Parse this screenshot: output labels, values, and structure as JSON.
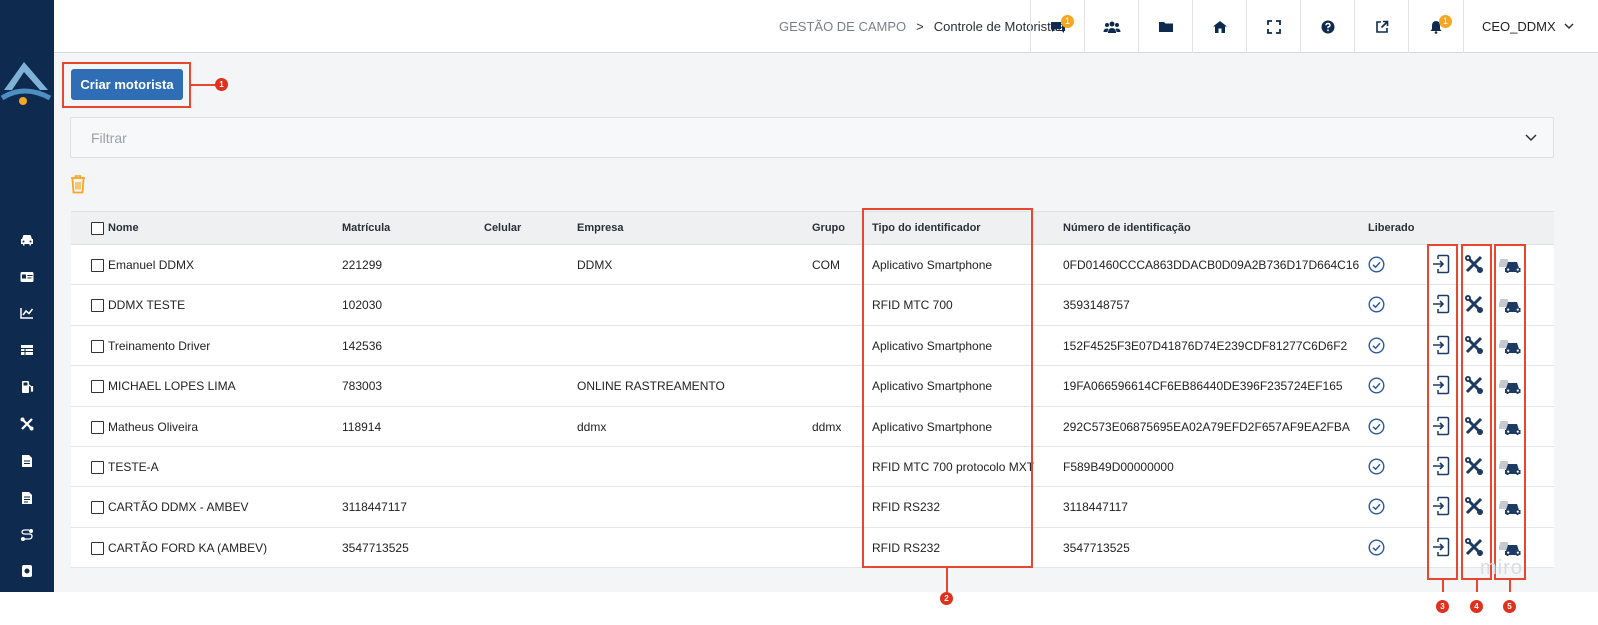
{
  "topbar": {
    "breadcrumb_parent": "GESTÃO DE CAMPO",
    "breadcrumb_sep": ">",
    "breadcrumb_current": "Controle de Motoristas",
    "chat_badge": "1",
    "notif_badge": "1",
    "user": "CEO_DDMX"
  },
  "main": {
    "create_button": "Criar motorista",
    "filter_placeholder": "Filtrar"
  },
  "table": {
    "columns": {
      "nome": "Nome",
      "matricula": "Matrícula",
      "celular": "Celular",
      "empresa": "Empresa",
      "grupo": "Grupo",
      "tipo": "Tipo do identificador",
      "numero": "Número de identificação",
      "liberado": "Liberado"
    },
    "rows": [
      {
        "nome": "Emanuel DDMX",
        "matricula": "221299",
        "celular": "",
        "empresa": "DDMX",
        "grupo": "COM",
        "tipo": "Aplicativo Smartphone",
        "numero": "0FD01460CCCA863DDACB0D09A2B736D17D664C16"
      },
      {
        "nome": "DDMX TESTE",
        "matricula": "102030",
        "celular": "",
        "empresa": "",
        "grupo": "",
        "tipo": "RFID MTC 700",
        "numero": "3593148757"
      },
      {
        "nome": "Treinamento Driver",
        "matricula": "142536",
        "celular": "",
        "empresa": "",
        "grupo": "",
        "tipo": "Aplicativo Smartphone",
        "numero": "152F4525F3E07D41876D74E239CDF81277C6D6F2"
      },
      {
        "nome": "MICHAEL LOPES LIMA",
        "matricula": "783003",
        "celular": "",
        "empresa": "ONLINE RASTREAMENTO",
        "grupo": "",
        "tipo": "Aplicativo Smartphone",
        "numero": "19FA066596614CF6EB86440DE396F235724EF165"
      },
      {
        "nome": "Matheus Oliveira",
        "matricula": "118914",
        "celular": "",
        "empresa": "ddmx",
        "grupo": "ddmx",
        "tipo": "Aplicativo Smartphone",
        "numero": "292C573E06875695EA02A79EFD2F657AF9EA2FBA"
      },
      {
        "nome": "TESTE-A",
        "matricula": "",
        "celular": "",
        "empresa": "",
        "grupo": "",
        "tipo": "RFID MTC 700 protocolo MXT",
        "numero": "F589B49D00000000"
      },
      {
        "nome": "CARTÃO DDMX - AMBEV",
        "matricula": "3118447117",
        "celular": "",
        "empresa": "",
        "grupo": "",
        "tipo": "RFID RS232",
        "numero": "3118447117"
      },
      {
        "nome": "CARTÃO FORD KA (AMBEV)",
        "matricula": "3547713525",
        "celular": "",
        "empresa": "",
        "grupo": "",
        "tipo": "RFID RS232",
        "numero": "3547713525"
      }
    ]
  },
  "annotations": {
    "m1": "1",
    "m2": "2",
    "m3": "3",
    "m4": "4",
    "m5": "5"
  },
  "watermark": "miro",
  "colors": {
    "sidebar": "#0e2a4f",
    "primary_button": "#2f6db5",
    "accent": "#f5a623",
    "annotation": "#e8472f"
  }
}
